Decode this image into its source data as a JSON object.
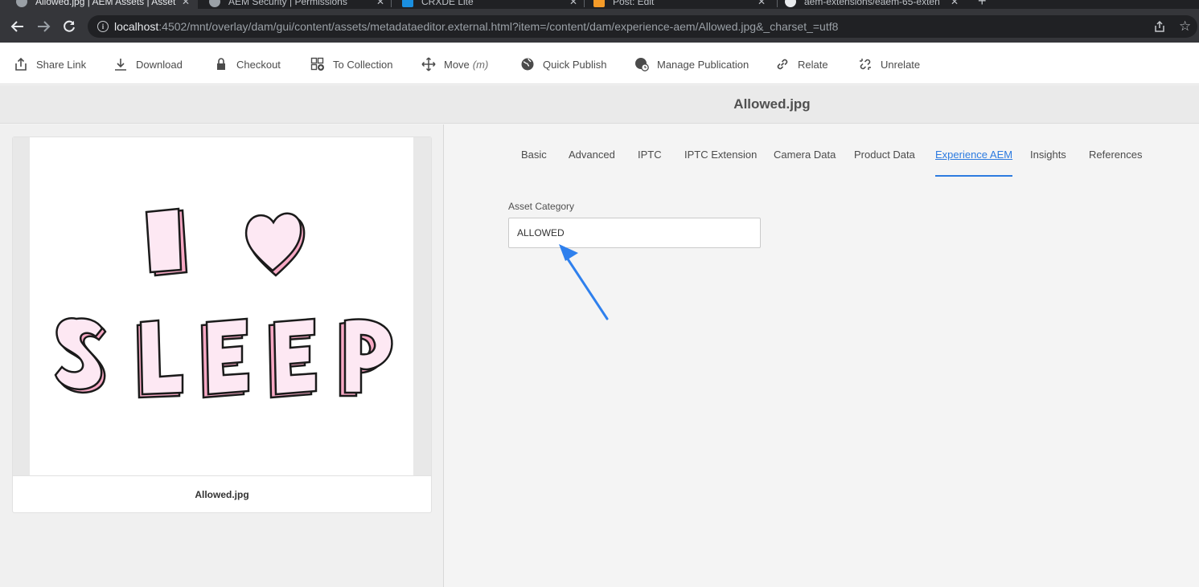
{
  "browser": {
    "tabs": [
      {
        "title": "Allowed.jpg | AEM Assets | Asset",
        "active": true
      },
      {
        "title": "AEM Security | Permissions",
        "active": false
      },
      {
        "title": "CRXDE Lite",
        "active": false
      },
      {
        "title": "Post: Edit",
        "active": false
      },
      {
        "title": "aem-extensions/eaem-65-exten",
        "active": false
      }
    ],
    "new_tab": "+",
    "url_host": "localhost",
    "url_rest": ":4502/mnt/overlay/dam/gui/content/assets/metadataeditor.external.html?item=/content/dam/experience-aem/Allowed.jpg&_charset_=utf8"
  },
  "actions": [
    {
      "label": "Share Link",
      "icon": "share-icon"
    },
    {
      "label": "Download",
      "icon": "download-icon"
    },
    {
      "label": "Checkout",
      "icon": "lock-icon"
    },
    {
      "label": "To Collection",
      "icon": "add-collection-icon"
    },
    {
      "label": "Move",
      "shortcut": "(m)",
      "icon": "move-icon"
    },
    {
      "label": "Quick Publish",
      "icon": "globe-icon"
    },
    {
      "label": "Manage Publication",
      "icon": "globe-clock-icon"
    },
    {
      "label": "Relate",
      "icon": "link-icon"
    },
    {
      "label": "Unrelate",
      "icon": "unlink-icon"
    }
  ],
  "page_title": "Allowed.jpg",
  "asset_card": {
    "title": "Allowed.jpg",
    "image_text": [
      "I",
      "♥",
      "S",
      "L",
      "E",
      "E",
      "P"
    ]
  },
  "metadata_tabs": [
    {
      "label": "Basic",
      "active": false
    },
    {
      "label": "Advanced",
      "active": false
    },
    {
      "label": "IPTC",
      "active": false
    },
    {
      "label": "IPTC Extension",
      "active": false
    },
    {
      "label": "Camera Data",
      "active": false
    },
    {
      "label": "Product Data",
      "active": false
    },
    {
      "label": "Experience AEM",
      "active": true
    },
    {
      "label": "Insights",
      "active": false
    },
    {
      "label": "References",
      "active": false
    }
  ],
  "form": {
    "asset_category_label": "Asset Category",
    "asset_category_value": "ALLOWED"
  },
  "colors": {
    "accent": "#2d7be0",
    "annotation_arrow": "#2f80ed",
    "letter_pink": "#f7a8c4",
    "letter_face": "#fde8f3"
  }
}
